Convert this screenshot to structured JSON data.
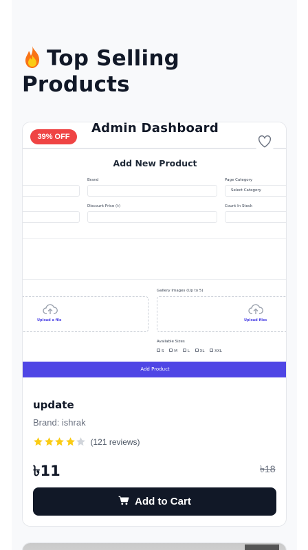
{
  "section": {
    "title": "Top Selling Products",
    "icon": "fire-icon"
  },
  "product": {
    "discount_badge": "39% OFF",
    "name": "update",
    "brand": "Brand: ishrak",
    "rating": 4,
    "rating_max": 5,
    "reviews": "(121 reviews)",
    "price": "৳11",
    "old_price": "৳18",
    "add_to_cart": "Add to Cart",
    "image": {
      "dashboard_title": "Admin Dashboard",
      "form_title": "Add New Product",
      "brand_label": "Brand",
      "page_category_label": "Page Category",
      "select_category": "Select Category",
      "discount_price_label": "Discount Price (৳)",
      "count_in_stock_label": "Count In Stock",
      "gallery_label": "Gallery Images (Up to 5)",
      "upload_a_file": "Upload a file",
      "upload_files": "Upload files",
      "available_sizes_label": "Available Sizes",
      "sizes": [
        "S",
        "M",
        "L",
        "XL",
        "XXL"
      ],
      "add_product_button": "Add Product"
    }
  },
  "colors": {
    "badge": "#ef4444",
    "button": "#111827",
    "star": "#facc15",
    "accent": "#4f46e5"
  }
}
